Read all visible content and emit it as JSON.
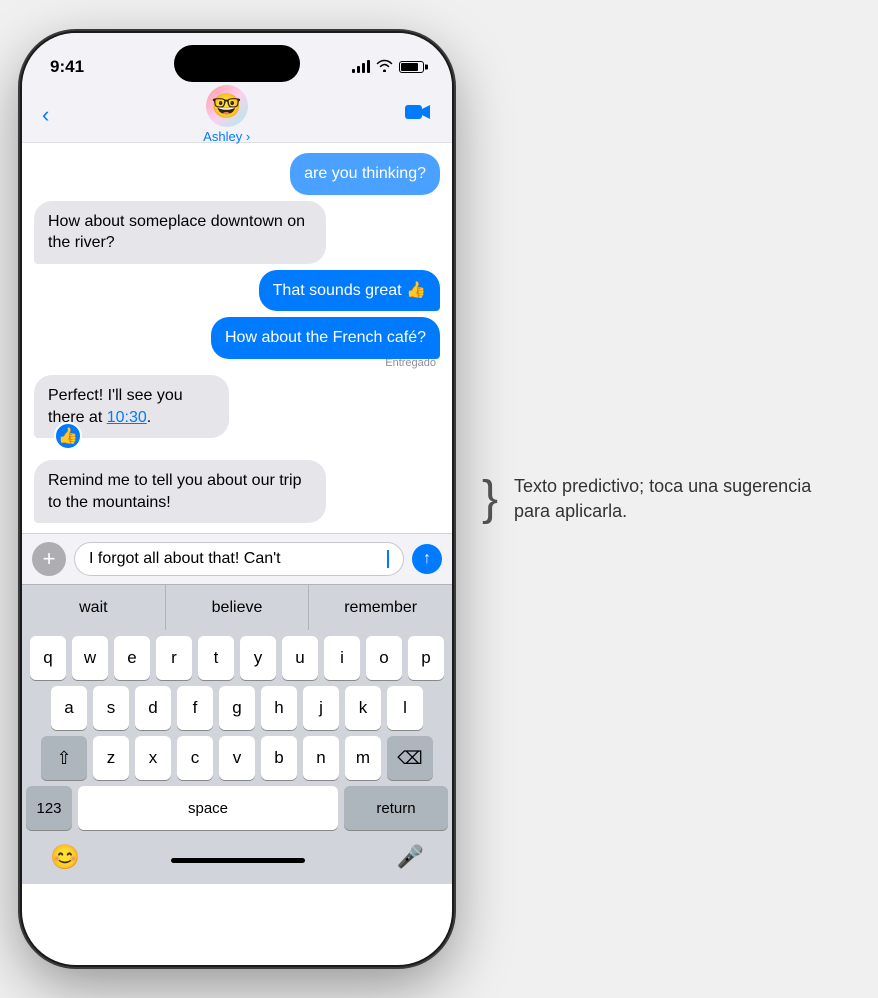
{
  "status_bar": {
    "time": "9:41",
    "signal_bars": [
      4,
      7,
      10,
      13
    ],
    "battery_level": 80
  },
  "nav": {
    "back_label": "",
    "contact_name": "Ashley",
    "contact_emoji": "🤓",
    "video_icon": "📹"
  },
  "messages": [
    {
      "id": "msg1",
      "type": "sent_partial",
      "text": "are you thinking?",
      "delivered": false
    },
    {
      "id": "msg2",
      "type": "received",
      "text": "How about someplace downtown on the river?",
      "delivered": false
    },
    {
      "id": "msg3",
      "type": "sent",
      "text": "That sounds great 👍",
      "delivered": false
    },
    {
      "id": "msg4",
      "type": "sent",
      "text": "How about the French café?",
      "delivered": true,
      "delivered_label": "Entregado"
    },
    {
      "id": "msg5",
      "type": "received_tapback",
      "text": "Perfect! I'll see you there at 10:30.",
      "tapback": "👍",
      "time_link": "10:30",
      "delivered": false
    },
    {
      "id": "msg6",
      "type": "received",
      "text": "Remind me to tell you about our trip to the mountains!",
      "delivered": false
    }
  ],
  "input": {
    "plus_icon": "+",
    "text": "I forgot all about that! Can't",
    "send_icon": "↑"
  },
  "predictive": {
    "words": [
      "wait",
      "believe",
      "remember"
    ]
  },
  "keyboard": {
    "rows": [
      [
        "q",
        "w",
        "e",
        "r",
        "t",
        "y",
        "u",
        "i",
        "o",
        "p"
      ],
      [
        "a",
        "s",
        "d",
        "f",
        "g",
        "h",
        "j",
        "k",
        "l"
      ],
      [
        "z",
        "x",
        "c",
        "v",
        "b",
        "n",
        "m"
      ]
    ],
    "special_shift": "⇧",
    "special_delete": "⌫",
    "special_num": "123",
    "special_space": "space",
    "special_return": "return",
    "special_emoji": "😊",
    "special_mic": "🎤"
  },
  "annotation": {
    "bracket": "⌋",
    "text": "Texto predictivo; toca una sugerencia para aplicarla."
  }
}
